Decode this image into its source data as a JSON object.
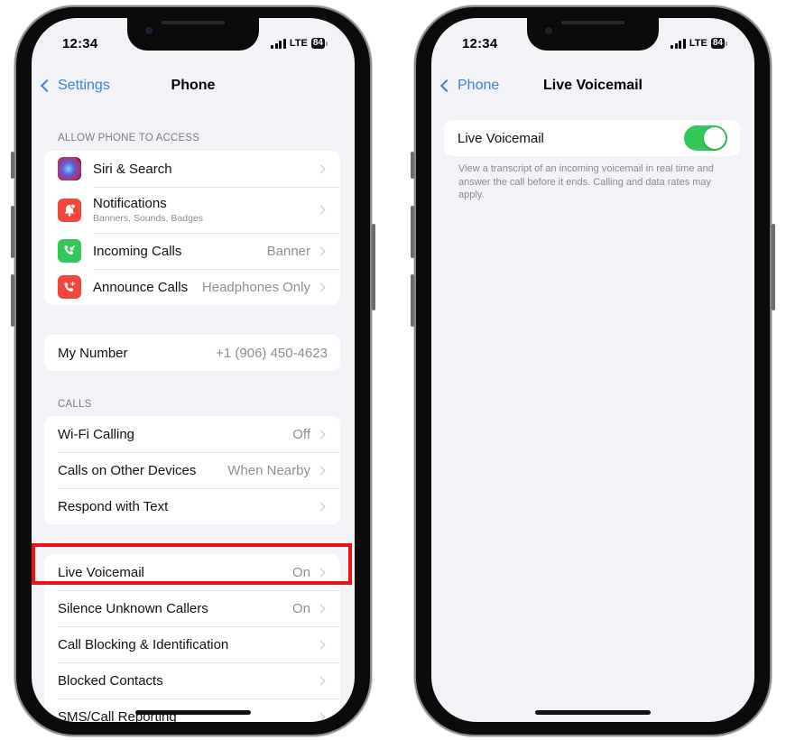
{
  "left_screen": {
    "status_bar": {
      "time": "12:34",
      "network": "LTE",
      "battery": "84"
    },
    "nav": {
      "back_label": "Settings",
      "title": "Phone"
    },
    "sections": {
      "allow_access": {
        "header": "ALLOW PHONE TO ACCESS",
        "items": [
          {
            "label": "Siri & Search",
            "icon": "siri-icon"
          },
          {
            "label": "Notifications",
            "subtitle": "Banners, Sounds, Badges",
            "icon": "notifications-bell-icon"
          },
          {
            "label": "Incoming Calls",
            "value": "Banner",
            "icon": "incoming-calls-icon"
          },
          {
            "label": "Announce Calls",
            "value": "Headphones Only",
            "icon": "announce-calls-icon"
          }
        ]
      },
      "my_number": {
        "label": "My Number",
        "value": "+1 (906) 450-4623"
      },
      "calls": {
        "header": "CALLS",
        "items": [
          {
            "label": "Wi-Fi Calling",
            "value": "Off"
          },
          {
            "label": "Calls on Other Devices",
            "value": "When Nearby"
          },
          {
            "label": "Respond with Text",
            "value": ""
          }
        ]
      },
      "voicemail": {
        "items": [
          {
            "label": "Live Voicemail",
            "value": "On"
          },
          {
            "label": "Silence Unknown Callers",
            "value": "On"
          },
          {
            "label": "Call Blocking & Identification",
            "value": ""
          },
          {
            "label": "Blocked Contacts",
            "value": ""
          },
          {
            "label": "SMS/Call Reporting",
            "value": ""
          }
        ]
      }
    },
    "highlight_color": "#e8121c"
  },
  "right_screen": {
    "status_bar": {
      "time": "12:34",
      "network": "LTE",
      "battery": "84"
    },
    "nav": {
      "back_label": "Phone",
      "title": "Live Voicemail"
    },
    "toggle_row": {
      "label": "Live Voicemail",
      "enabled": true
    },
    "footnote": "View a transcript of an incoming voicemail in real time and answer the call before it ends. Calling and data rates may apply.",
    "accent_color": "#34c759"
  },
  "colors": {
    "link_blue": "#3b82d6",
    "background": "#f2f2f7",
    "secondary_text": "#8e8e93"
  }
}
